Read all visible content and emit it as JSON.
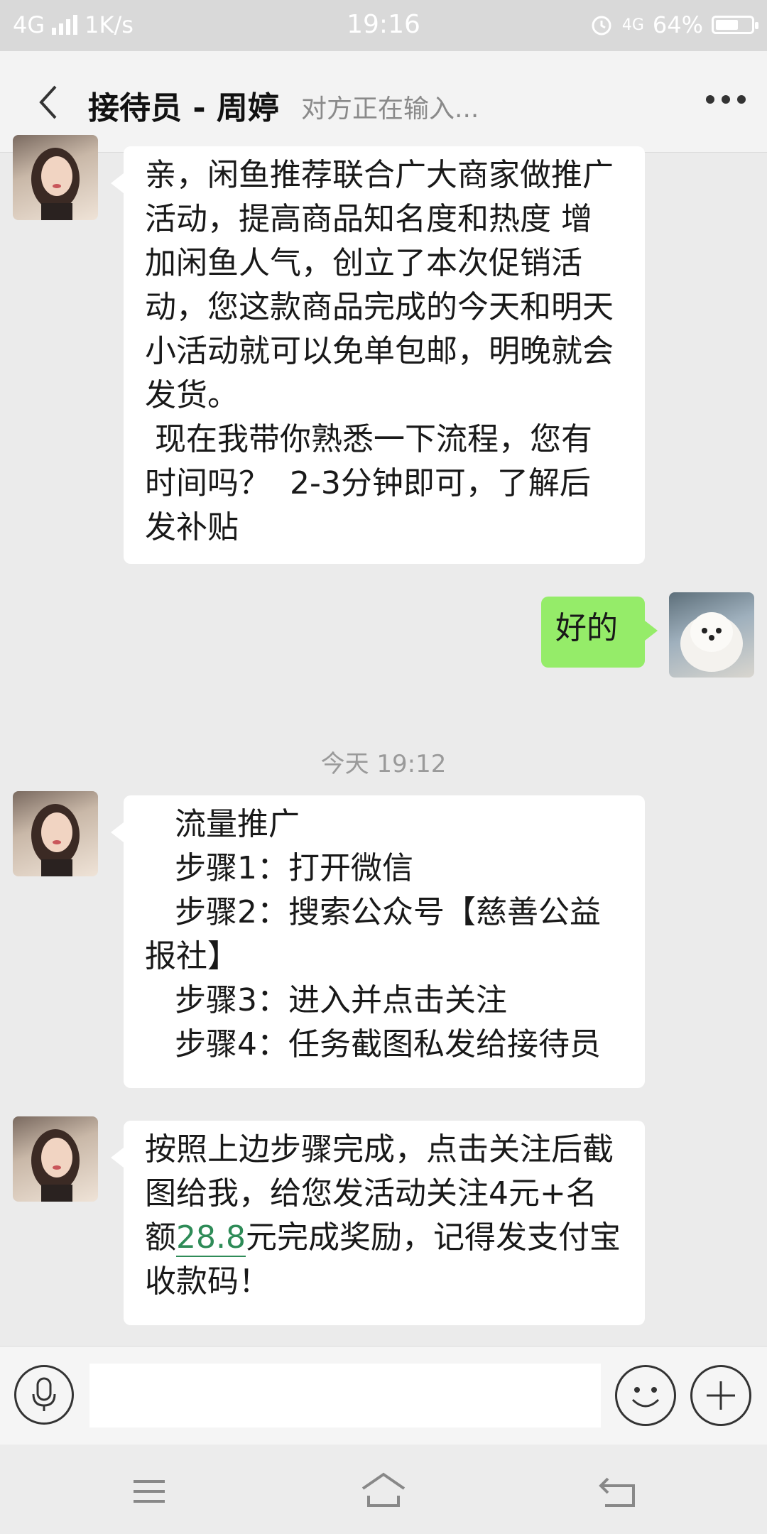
{
  "status_bar": {
    "network": "4G",
    "speed": "1K/s",
    "time": "19:16",
    "right_network": "4G",
    "battery_percent": "64%",
    "battery_level": 0.64
  },
  "header": {
    "title": "接待员 - 周婷",
    "typing_status": "对方正在输入..."
  },
  "messages": {
    "m1": {
      "sender": "other",
      "text": "亲，闲鱼推荐联合广大商家做推广\n活动，提高商品知名度和热度 增\n加闲鱼人气，创立了本次促销活\n动，您这款商品完成的今天和明天\n小活动就可以免单包邮，明晚就会\n发货。\n 现在我带你熟悉一下流程，您有\n时间吗？  2-3分钟即可，了解后\n发补贴"
    },
    "m2": {
      "sender": "me",
      "text": "好的"
    },
    "timestamp": "今天 19:12",
    "m3": {
      "sender": "other",
      "text": "   流量推广\n   步骤1：打开微信\n   步骤2：搜索公众号【慈善公益\n报社】\n   步骤3：进入并点击关注\n   步骤4：任务截图私发给接待员"
    },
    "m4": {
      "sender": "other",
      "text_before": "按照上边步骤完成，点击关注后截\n图给我，给您发活动关注4元+名\n额",
      "amount": "28.8",
      "text_after": "元完成奖励，记得发支付宝\n收款码！"
    }
  },
  "input_bar": {
    "placeholder": ""
  },
  "colors": {
    "my_bubble": "#95ec69",
    "other_bubble": "#ffffff",
    "chat_bg": "#ebebeb",
    "link": "#2e8b57"
  }
}
